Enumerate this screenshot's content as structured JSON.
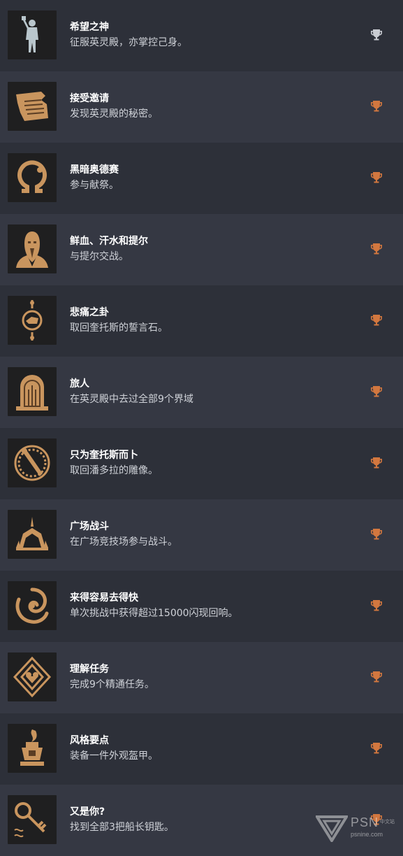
{
  "trophies": [
    {
      "title": "希望之神",
      "desc": "征服英灵殿，亦掌控己身。",
      "icon": "warrior-statue-icon",
      "grade": "platinum"
    },
    {
      "title": "接受邀请",
      "desc": "发现英灵殿的秘密。",
      "icon": "scroll-icon",
      "grade": "bronze"
    },
    {
      "title": "黑暗奥德赛",
      "desc": "参与献祭。",
      "icon": "omega-icon",
      "grade": "bronze"
    },
    {
      "title": "鲜血、汗水和提尔",
      "desc": "与提尔交战。",
      "icon": "tyr-portrait-icon",
      "grade": "bronze"
    },
    {
      "title": "悲痛之卦",
      "desc": "取回奎托斯的誓言石。",
      "icon": "oath-stone-icon",
      "grade": "bronze"
    },
    {
      "title": "旅人",
      "desc": "在英灵殿中去过全部9个界域",
      "icon": "realm-door-icon",
      "grade": "bronze"
    },
    {
      "title": "只为奎托斯而卜",
      "desc": "取回潘多拉的雕像。",
      "icon": "pandora-statue-icon",
      "grade": "bronze"
    },
    {
      "title": "广场战斗",
      "desc": "在广场竞技场参与战斗。",
      "icon": "arena-tent-icon",
      "grade": "bronze"
    },
    {
      "title": "来得容易去得快",
      "desc": "单次挑战中获得超过15000闪现回响。",
      "icon": "swirl-echo-icon",
      "grade": "bronze"
    },
    {
      "title": "理解任务",
      "desc": "完成9个精通任务。",
      "icon": "mastery-emblem-icon",
      "grade": "bronze"
    },
    {
      "title": "风格要点",
      "desc": "装备一件外观盔甲。",
      "icon": "armor-flame-icon",
      "grade": "bronze"
    },
    {
      "title": "又是你?",
      "desc": "找到全部3把船长钥匙。",
      "icon": "captain-key-icon",
      "grade": "bronze"
    }
  ],
  "colors": {
    "platinum": "#c9ccd2",
    "bronze": "#d2773f",
    "icon_gold": "#c9955e",
    "icon_dark": "#5a3d24"
  },
  "watermark": {
    "brand": "PSN",
    "tagline": "中文站",
    "site": "psnine.com"
  }
}
